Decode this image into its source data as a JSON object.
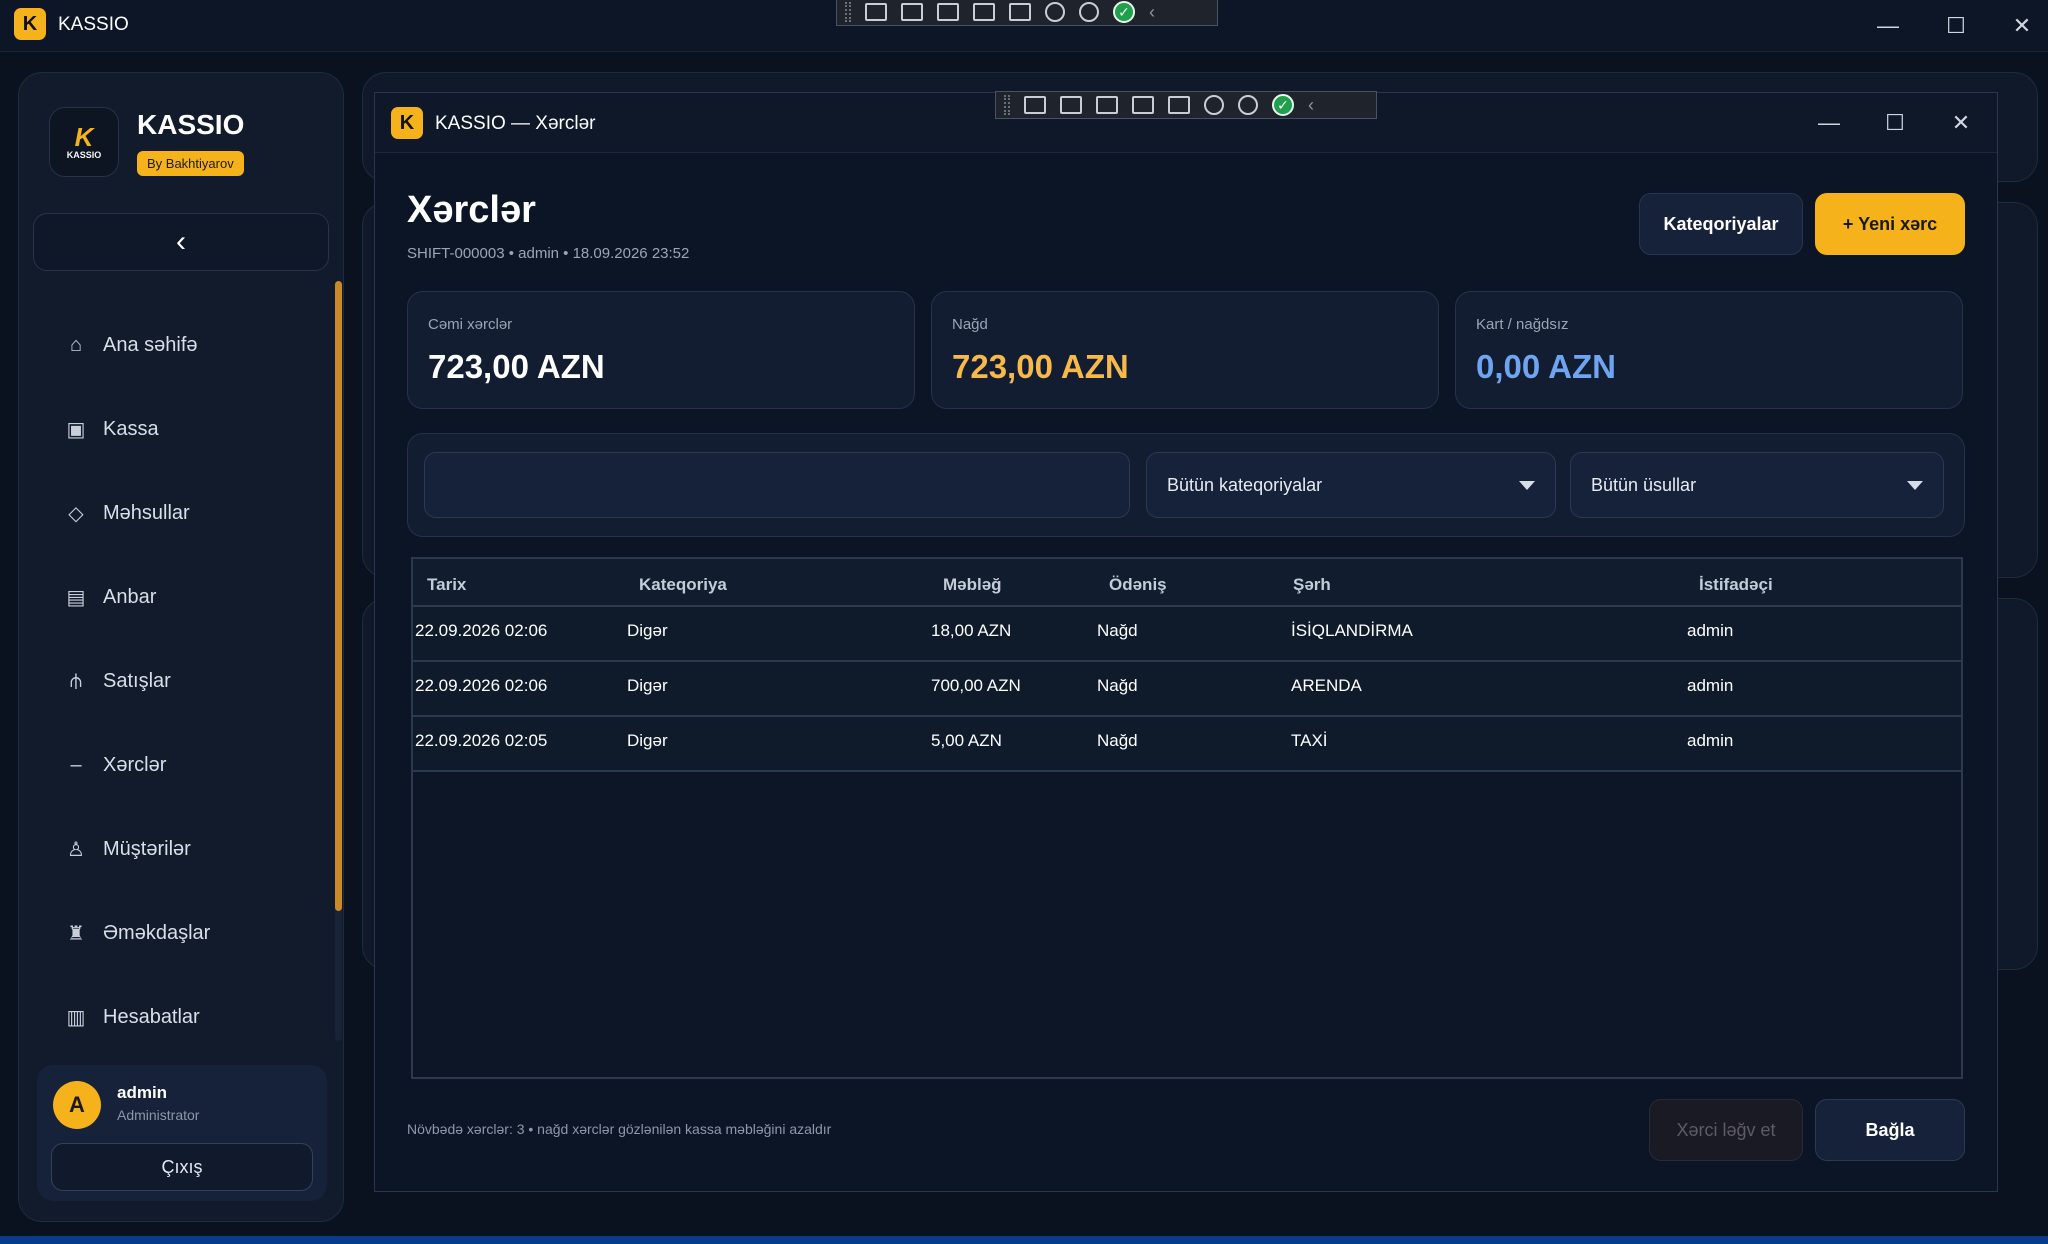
{
  "window": {
    "title": "KASSIO",
    "logo_letter": "K"
  },
  "sidebar": {
    "brand_name": "KASSIO",
    "brand_badge": "By Bakhtiyarov",
    "brand_logo_text": "KASSIO",
    "collapse_icon": "‹",
    "items": [
      {
        "label": "Ana səhifə",
        "icon": "home-icon",
        "glyph": "⌂"
      },
      {
        "label": "Kassa",
        "icon": "cash-register-icon",
        "glyph": "▣"
      },
      {
        "label": "Məhsullar",
        "icon": "diamond-icon",
        "glyph": "◇"
      },
      {
        "label": "Anbar",
        "icon": "warehouse-icon",
        "glyph": "▤"
      },
      {
        "label": "Satışlar",
        "icon": "sales-icon",
        "glyph": "⫛"
      },
      {
        "label": "Xərclər",
        "icon": "minus-icon",
        "glyph": "–"
      },
      {
        "label": "Müştərilər",
        "icon": "customer-icon",
        "glyph": "♙"
      },
      {
        "label": "Əməkdaşlar",
        "icon": "staff-icon",
        "glyph": "♜"
      },
      {
        "label": "Hesabatlar",
        "icon": "reports-icon",
        "glyph": "▥"
      }
    ],
    "user": {
      "initial": "A",
      "name": "admin",
      "role": "Administrator",
      "logout_label": "Çıxış"
    }
  },
  "dialog": {
    "title": "KASSIO — Xərclər",
    "page_title": "Xərclər",
    "subtitle": "SHIFT-000003 • admin • 18.09.2026 23:52",
    "categories_button": "Kateqoriyalar",
    "new_button": "+ Yeni xərc",
    "stats": [
      {
        "label": "Cəmi xərclər",
        "value": "723,00 AZN",
        "color": "#ffffff"
      },
      {
        "label": "Nağd",
        "value": "723,00 AZN",
        "color": "#f6b94a"
      },
      {
        "label": "Kart / nağdsız",
        "value": "0,00 AZN",
        "color": "#6fa4f0"
      }
    ],
    "filters": {
      "search_value": "",
      "search_placeholder": "",
      "category_select": "Bütün kateqoriyalar",
      "method_select": "Bütün üsullar"
    },
    "table": {
      "headers": [
        "Tarix",
        "Kateqoriya",
        "Məbləğ",
        "Ödəniş",
        "Şərh",
        "İstifadəçi"
      ],
      "rows": [
        [
          "22.09.2026 02:06",
          "Digər",
          "18,00 AZN",
          "Nağd",
          "İSİQLANDİRMA",
          "admin"
        ],
        [
          "22.09.2026 02:06",
          "Digər",
          "700,00 AZN",
          "Nağd",
          "ARENDA",
          "admin"
        ],
        [
          "22.09.2026 02:05",
          "Digər",
          "5,00 AZN",
          "Nağd",
          "TAXİ",
          "admin"
        ]
      ]
    },
    "footer_note": "Növbədə xərclər: 3 • nağd xərclər gözlənilən kassa məbləğini azaldır",
    "cancel_button": "Xərci ləğv et",
    "close_button": "Bağla"
  },
  "colors": {
    "accent": "#f6b21b",
    "background": "#0a1220",
    "panel": "#121d31"
  }
}
